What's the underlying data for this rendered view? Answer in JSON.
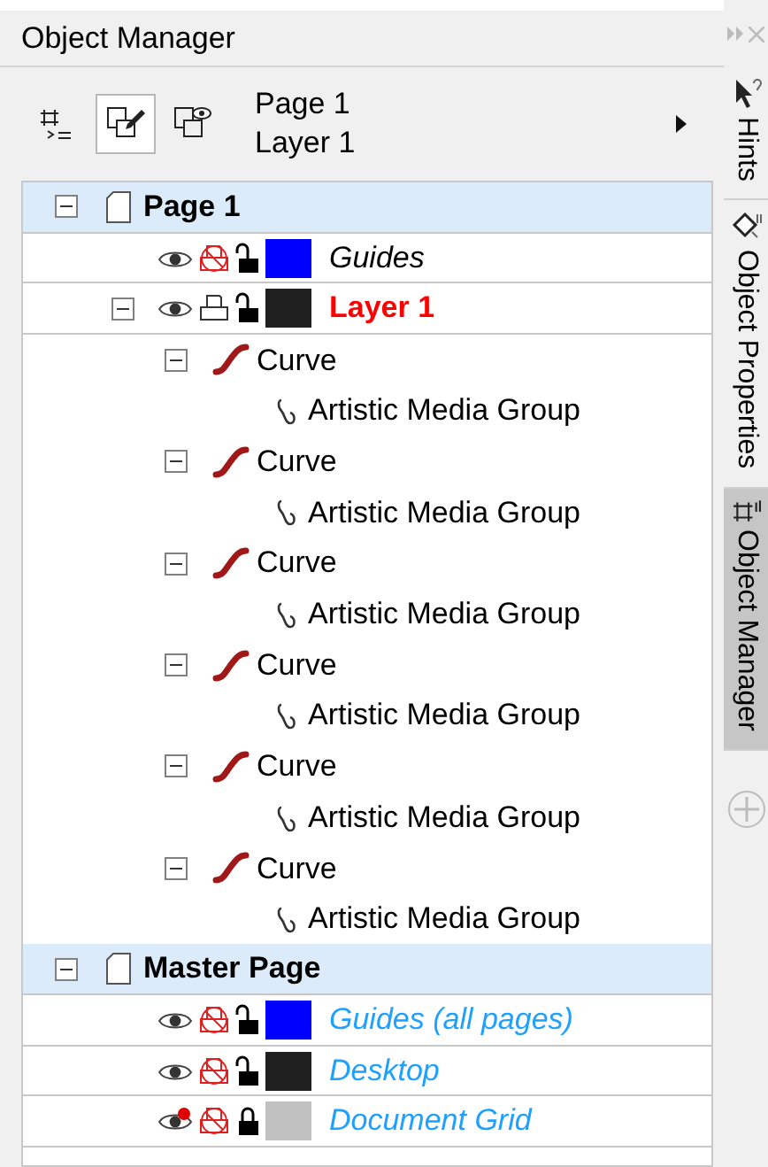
{
  "panel": {
    "title": "Object Manager"
  },
  "toolbar": {
    "page": "Page 1",
    "layer": "Layer 1",
    "buttons": [
      {
        "kind": "properties",
        "selected": false
      },
      {
        "kind": "edit",
        "selected": true
      },
      {
        "kind": "view",
        "selected": false
      }
    ]
  },
  "tree": [
    {
      "name": "Page 1",
      "kind": "page",
      "expanded": true,
      "children": [
        {
          "name": "Guides",
          "kind": "layer",
          "visible": true,
          "printable": false,
          "locked": false,
          "color": "#0000ff",
          "active": false,
          "master": false
        },
        {
          "name": "Layer 1",
          "kind": "layer",
          "expanded": true,
          "visible": true,
          "printable": true,
          "locked": false,
          "color": "#202020",
          "active": true,
          "master": false,
          "children": [
            {
              "name": "Curve",
              "kind": "curve",
              "expanded": true,
              "children": [
                {
                  "name": "Artistic Media Group",
                  "kind": "group"
                }
              ]
            },
            {
              "name": "Curve",
              "kind": "curve",
              "expanded": true,
              "children": [
                {
                  "name": "Artistic Media Group",
                  "kind": "group"
                }
              ]
            },
            {
              "name": "Curve",
              "kind": "curve",
              "expanded": true,
              "children": [
                {
                  "name": "Artistic Media Group",
                  "kind": "group"
                }
              ]
            },
            {
              "name": "Curve",
              "kind": "curve",
              "expanded": true,
              "children": [
                {
                  "name": "Artistic Media Group",
                  "kind": "group"
                }
              ]
            },
            {
              "name": "Curve",
              "kind": "curve",
              "expanded": true,
              "children": [
                {
                  "name": "Artistic Media Group",
                  "kind": "group"
                }
              ]
            },
            {
              "name": "Curve",
              "kind": "curve",
              "expanded": true,
              "children": [
                {
                  "name": "Artistic Media Group",
                  "kind": "group"
                }
              ]
            }
          ]
        }
      ]
    },
    {
      "name": "Master Page",
      "kind": "page",
      "expanded": true,
      "children": [
        {
          "name": "Guides (all pages)",
          "kind": "layer",
          "visible": true,
          "printable": false,
          "locked": false,
          "color": "#0000ff",
          "active": false,
          "master": true
        },
        {
          "name": "Desktop",
          "kind": "layer",
          "visible": true,
          "printable": false,
          "locked": false,
          "color": "#202020",
          "active": false,
          "master": true
        },
        {
          "name": "Document Grid",
          "kind": "layer",
          "visible": false,
          "printable": false,
          "locked": true,
          "color": "#c0c0c0",
          "active": false,
          "master": true
        }
      ]
    }
  ],
  "side_tabs": [
    {
      "label": "Hints",
      "kind": "hints",
      "selected": false
    },
    {
      "label": "Object Properties",
      "kind": "properties",
      "selected": false
    },
    {
      "label": "Object Manager",
      "kind": "manager",
      "selected": true
    }
  ]
}
